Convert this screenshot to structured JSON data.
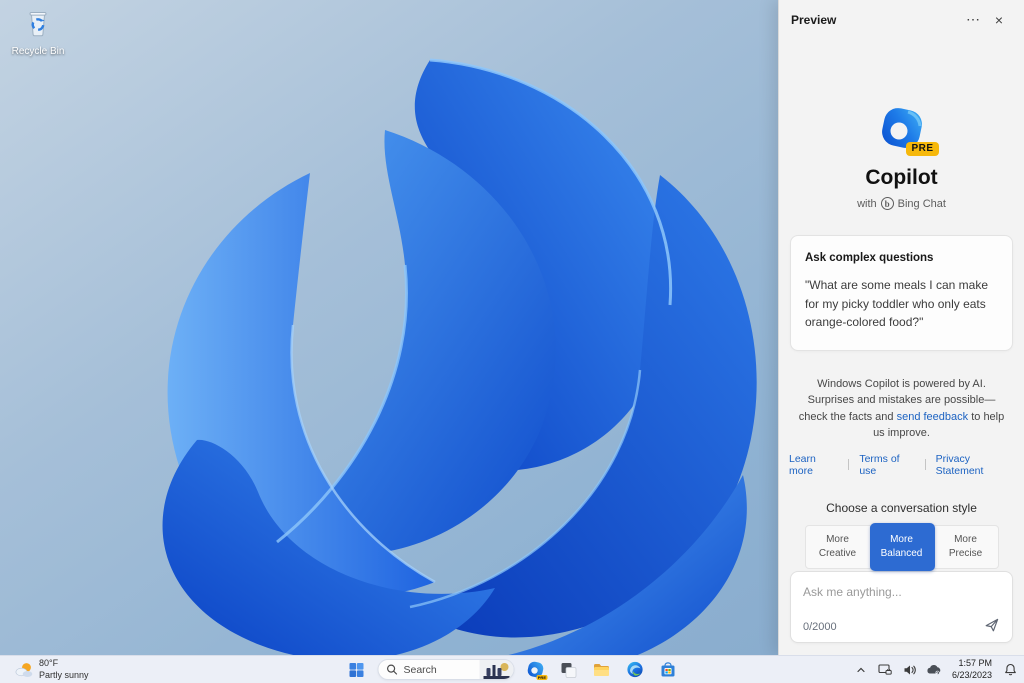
{
  "colors": {
    "accent_blue": "#2d6bd2",
    "link_blue": "#1d63c2",
    "badge_gold": "#f6b80b",
    "sidebar_bg": "#f3f3f3",
    "taskbar_bg": "#eceff7"
  },
  "desktop": {
    "recycle_bin_label": "Recycle Bin",
    "wallpaper": "windows-11-blue-bloom"
  },
  "sidebar": {
    "header": {
      "title": "Preview",
      "more_glyph": "⋯",
      "close_glyph": "×"
    },
    "branding": {
      "badge": "PRE",
      "title": "Copilot",
      "subtitle_prefix": "with",
      "bing_glyph": "b",
      "subtitle_suffix": "Bing Chat"
    },
    "suggestion_card": {
      "title": "Ask complex questions",
      "quote": "\"What are some meals I can make for my picky toddler who only eats orange-colored food?\""
    },
    "disclaimer": {
      "text_before": "Windows Copilot is powered by AI. Surprises and mistakes are possible—check the facts and ",
      "link": "send feedback",
      "text_after": " to help us improve."
    },
    "links": [
      "Learn more",
      "Terms of use",
      "Privacy Statement"
    ],
    "style_chooser": {
      "label": "Choose a conversation style",
      "options": [
        {
          "line1": "More",
          "line2": "Creative",
          "selected": false
        },
        {
          "line1": "More",
          "line2": "Balanced",
          "selected": true
        },
        {
          "line1": "More",
          "line2": "Precise",
          "selected": false
        }
      ]
    },
    "input": {
      "placeholder": "Ask me anything...",
      "counter": "0/2000"
    }
  },
  "taskbar": {
    "weather": {
      "temp": "80°F",
      "condition": "Partly sunny"
    },
    "search": {
      "placeholder": "Search"
    },
    "center_icons": [
      "start",
      "search",
      "copilot",
      "task-view",
      "file-explorer",
      "edge",
      "microsoft-store"
    ],
    "copilot_badge": "PRE",
    "tray_icons": [
      "hidden-icons-chevron",
      "network",
      "volume",
      "onedrive-cloud",
      "clock",
      "notifications-bell"
    ],
    "tray": {
      "time": "1:57 PM",
      "date": "6/23/2023"
    }
  }
}
